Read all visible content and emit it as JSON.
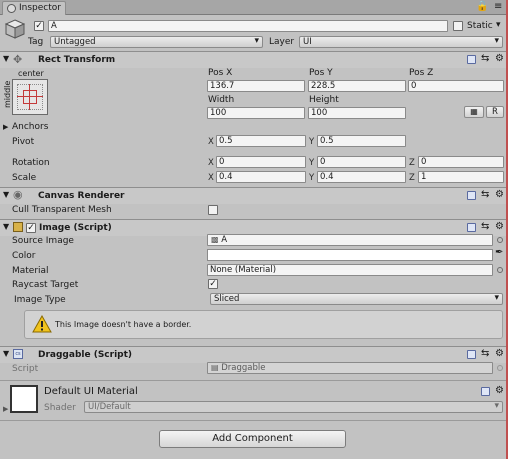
{
  "tab": {
    "label": "Inspector"
  },
  "object": {
    "name": "A",
    "static_label": "Static",
    "tag_label": "Tag",
    "tag_value": "Untagged",
    "layer_label": "Layer",
    "layer_value": "UI"
  },
  "rect_transform": {
    "title": "Rect Transform",
    "anchor_h": "center",
    "anchor_v": "middle",
    "pos_x_label": "Pos X",
    "pos_y_label": "Pos Y",
    "pos_z_label": "Pos Z",
    "pos_x": "136.7",
    "pos_y": "228.5",
    "pos_z": "0",
    "width_label": "Width",
    "height_label": "Height",
    "width": "100",
    "height": "100",
    "r_button": "R",
    "anchors_label": "Anchors",
    "pivot_label": "Pivot",
    "pivot_x": "0.5",
    "pivot_y": "0.5",
    "rotation_label": "Rotation",
    "rot_x": "0",
    "rot_y": "0",
    "rot_z": "0",
    "scale_label": "Scale",
    "scale_x": "0.4",
    "scale_y": "0.4",
    "scale_z": "1",
    "x": "X",
    "y": "Y",
    "z": "Z"
  },
  "canvas_renderer": {
    "title": "Canvas Renderer",
    "cull_label": "Cull Transparent Mesh"
  },
  "image": {
    "title": "Image (Script)",
    "source_label": "Source Image",
    "source_value": "A",
    "color_label": "Color",
    "material_label": "Material",
    "material_value": "None (Material)",
    "raycast_label": "Raycast Target",
    "type_label": "Image Type",
    "type_value": "Sliced",
    "warning": "This Image doesn't have a border."
  },
  "draggable": {
    "title": "Draggable (Script)",
    "script_label": "Script",
    "script_value": "Draggable"
  },
  "material": {
    "title": "Default UI Material",
    "shader_label": "Shader",
    "shader_value": "UI/Default"
  },
  "add_component": "Add Component"
}
